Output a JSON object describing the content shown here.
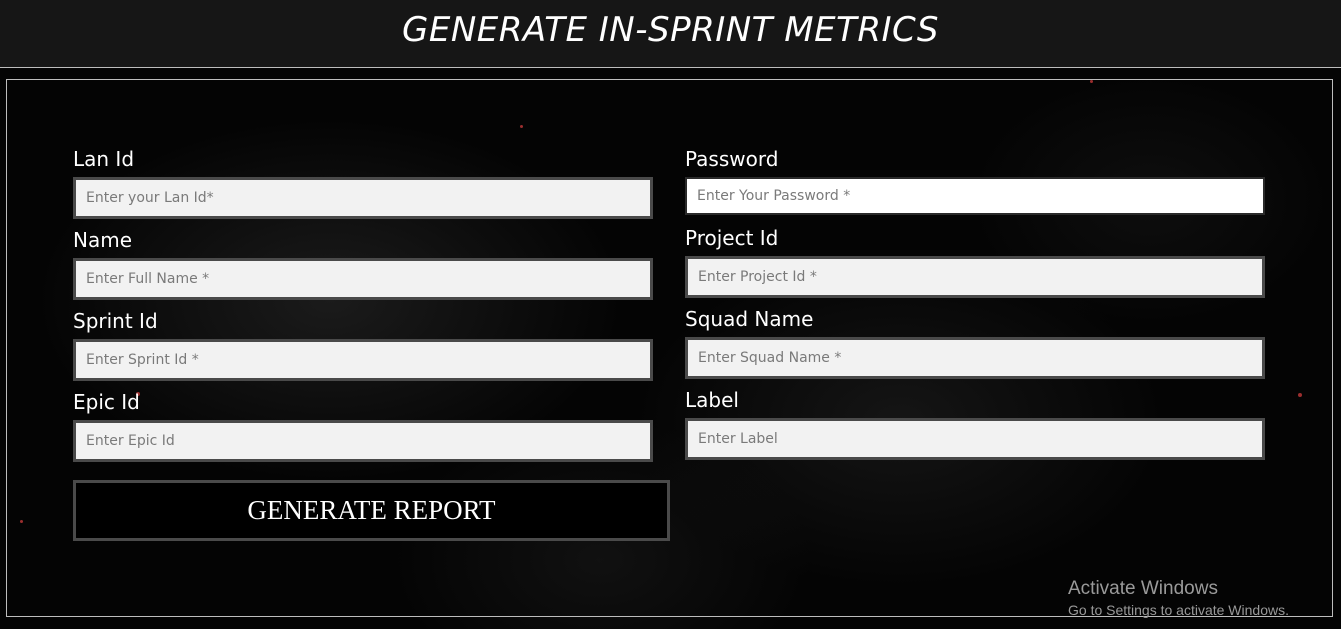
{
  "header": {
    "title": "GENERATE IN-SPRINT METRICS"
  },
  "form": {
    "left": [
      {
        "label": "Lan Id",
        "placeholder": "Enter your Lan Id*",
        "value": ""
      },
      {
        "label": "Name",
        "placeholder": "Enter Full Name *",
        "value": ""
      },
      {
        "label": "Sprint Id",
        "placeholder": "Enter Sprint Id *",
        "value": ""
      },
      {
        "label": "Epic Id",
        "placeholder": "Enter Epic Id",
        "value": ""
      }
    ],
    "right": [
      {
        "label": "Password",
        "placeholder": "Enter Your Password *",
        "value": ""
      },
      {
        "label": "Project Id",
        "placeholder": "Enter Project Id *",
        "value": ""
      },
      {
        "label": "Squad Name",
        "placeholder": "Enter Squad Name *",
        "value": ""
      },
      {
        "label": "Label",
        "placeholder": "Enter Label",
        "value": ""
      }
    ],
    "submit_label": "GENERATE REPORT"
  },
  "watermark": {
    "title": "Activate Windows",
    "subtitle": "Go to Settings to activate Windows."
  },
  "colors": {
    "background": "#050505",
    "header_bg": "#161616",
    "input_bg": "#f2f2f2",
    "input_border": "#4a4a4a",
    "text": "#ffffff"
  }
}
